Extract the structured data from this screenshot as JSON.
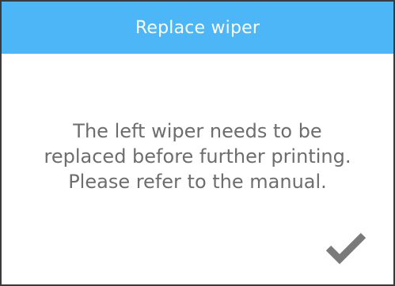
{
  "dialog": {
    "title": "Replace wiper",
    "message_lines": [
      "The left wiper needs to be",
      "replaced before further printing.",
      "Please refer to the manual."
    ],
    "confirm_icon": "checkmark-icon"
  },
  "colors": {
    "header_bg": "#4db6f7",
    "header_text": "#ffffff",
    "body_text": "#6d6d6d",
    "icon": "#7a7a7a",
    "border": "#3a3a3a"
  }
}
